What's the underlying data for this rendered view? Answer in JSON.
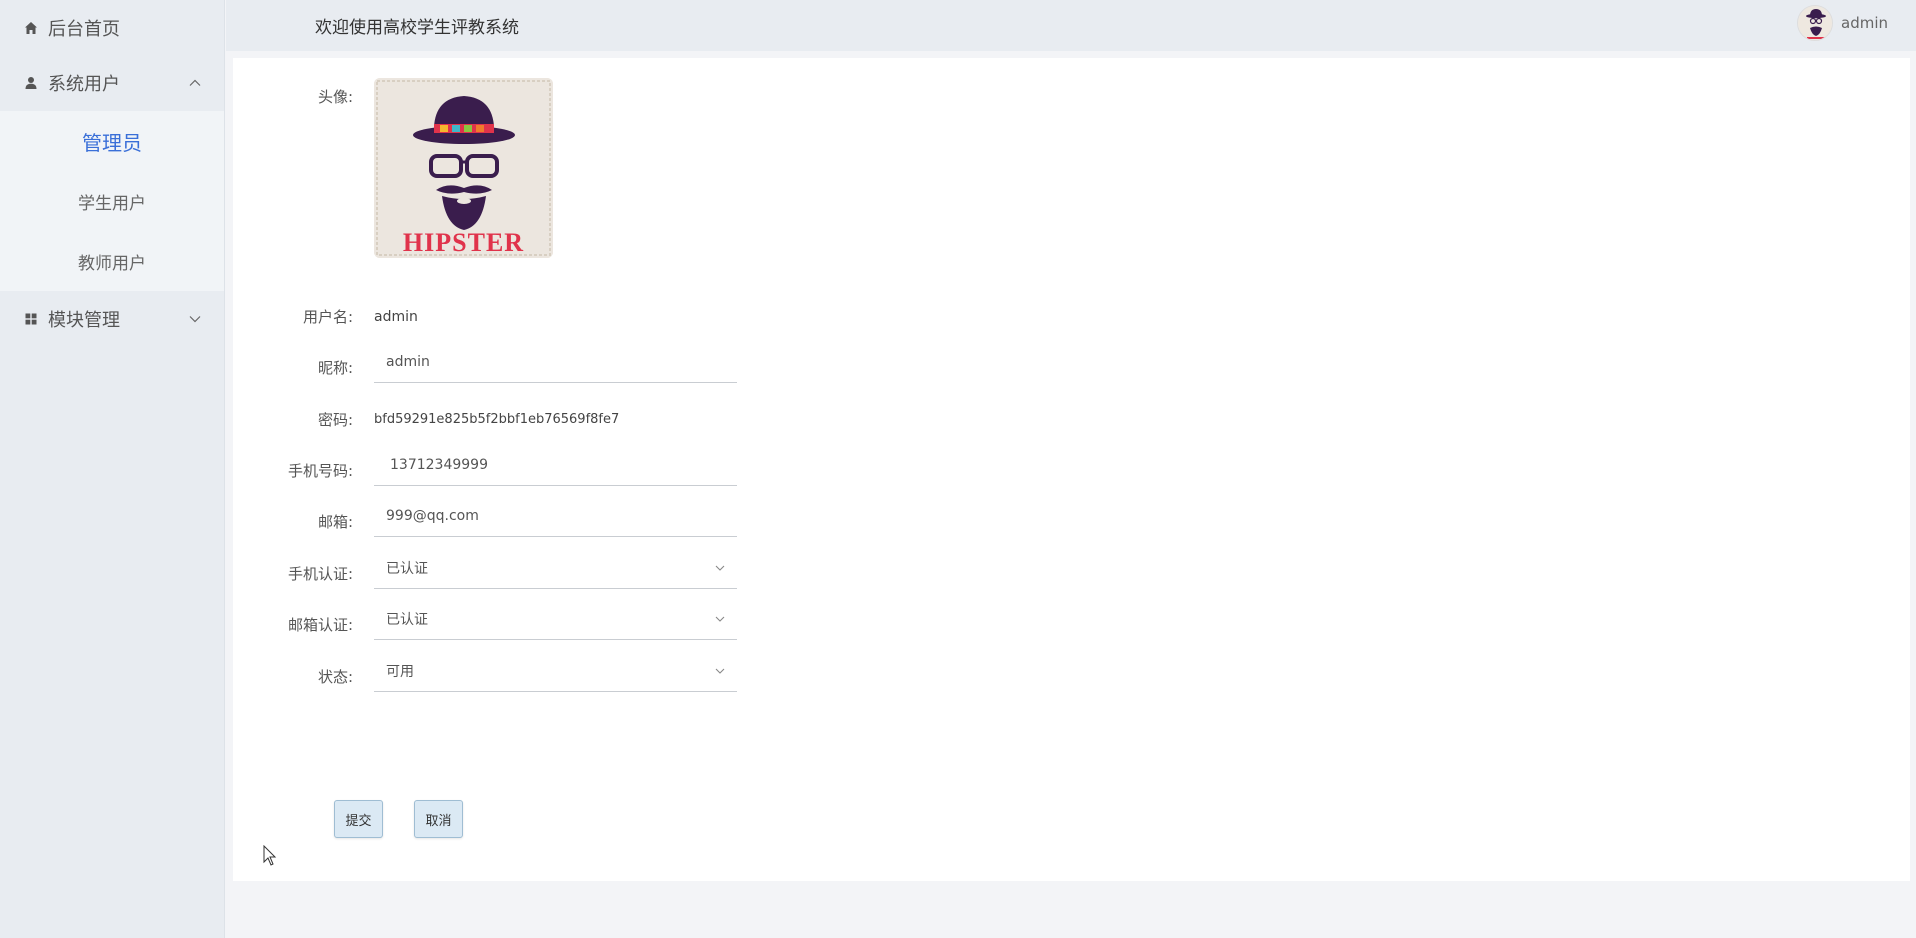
{
  "sidebar": {
    "home": {
      "label": "后台首页",
      "icon": "home-icon"
    },
    "groups": [
      {
        "label": "系统用户",
        "icon": "user-icon",
        "expanded": true,
        "items": [
          {
            "label": "管理员",
            "active": true
          },
          {
            "label": "学生用户",
            "active": false
          },
          {
            "label": "教师用户",
            "active": false
          }
        ]
      },
      {
        "label": "模块管理",
        "icon": "grid-icon",
        "expanded": false
      }
    ]
  },
  "header": {
    "title": "欢迎使用高校学生评教系统",
    "username": "admin"
  },
  "form": {
    "avatar_label": "头像:",
    "avatar_text": "HIPSTER",
    "username_label": "用户名:",
    "username_value": "admin",
    "nickname_label": "昵称:",
    "nickname_value": "admin",
    "password_label": "密码:",
    "password_value": "bfd59291e825b5f2bbf1eb76569f8fe7",
    "phone_label": "手机号码:",
    "phone_value": "13712349999",
    "email_label": "邮箱:",
    "email_value": "999@qq.com",
    "phone_verify_label": "手机认证:",
    "phone_verify_value": "已认证",
    "email_verify_label": "邮箱认证:",
    "email_verify_value": "已认证",
    "status_label": "状态:",
    "status_value": "可用",
    "submit_label": "提交",
    "cancel_label": "取消"
  },
  "colors": {
    "accent": "#3a6fd8",
    "sidebar_bg": "#e8ecf1",
    "button_bg": "#dbe9f4"
  }
}
